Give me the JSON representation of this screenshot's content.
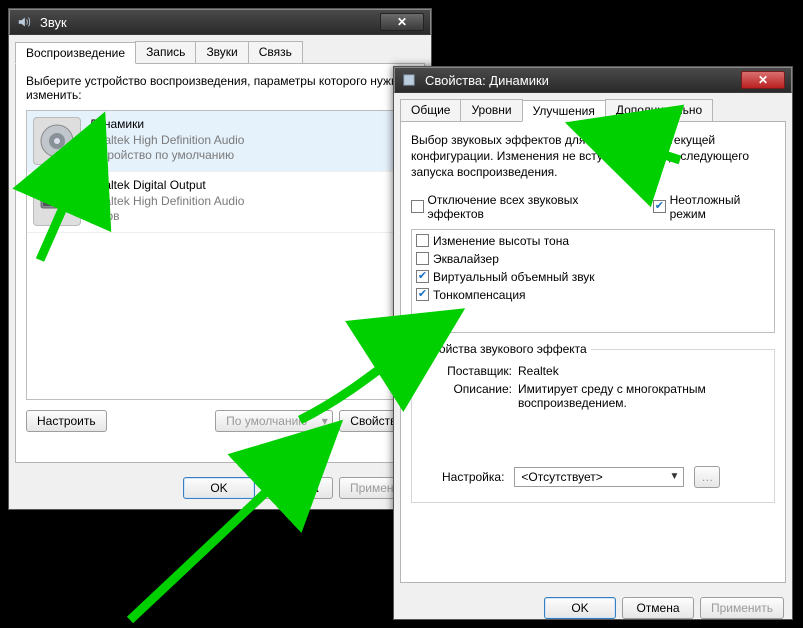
{
  "sound_window": {
    "title": "Звук",
    "tabs": [
      "Воспроизведение",
      "Запись",
      "Звуки",
      "Связь"
    ],
    "active_tab": 0,
    "prompt": "Выберите устройство воспроизведения, параметры которого нужно изменить:",
    "devices": [
      {
        "name": "Динамики",
        "driver": "Realtek High Definition Audio",
        "status": "Устройство по умолчанию",
        "selected": true,
        "default_check": true,
        "icon": "speaker-icon"
      },
      {
        "name": "Realtek Digital Output",
        "driver": "Realtek High Definition Audio",
        "status": "Готов",
        "selected": false,
        "default_check": false,
        "icon": "digital-output-icon"
      }
    ],
    "buttons": {
      "configure": "Настроить",
      "default": "По умолчанию",
      "properties": "Свойства",
      "ok": "OK",
      "cancel": "Отмена",
      "apply": "Применить"
    }
  },
  "props_window": {
    "title": "Свойства: Динамики",
    "tabs": [
      "Общие",
      "Уровни",
      "Улучшения",
      "Дополнительно"
    ],
    "active_tab": 2,
    "description": "Выбор звуковых эффектов для применения к текущей конфигурации. Изменения не вступят в силу до следующего запуска воспроизведения.",
    "disable_all": {
      "label": "Отключение всех звуковых эффектов",
      "checked": false
    },
    "urgent_mode": {
      "label": "Неотложный режим",
      "checked": true
    },
    "effects": [
      {
        "label": "Изменение высоты тона",
        "checked": false
      },
      {
        "label": "Эквалайзер",
        "checked": false
      },
      {
        "label": "Виртуальный объемный звук",
        "checked": true
      },
      {
        "label": "Тонкомпенсация",
        "checked": true
      }
    ],
    "group_legend": "Свойства звукового эффекта",
    "provider": {
      "label": "Поставщик:",
      "value": "Realtek"
    },
    "desc_label": "Описание:",
    "desc_value": "Имитирует среду с многократным воспроизведением.",
    "setting": {
      "label": "Настройка:",
      "value": "<Отсутствует>"
    },
    "buttons": {
      "ok": "OK",
      "cancel": "Отмена",
      "apply": "Применить"
    }
  }
}
